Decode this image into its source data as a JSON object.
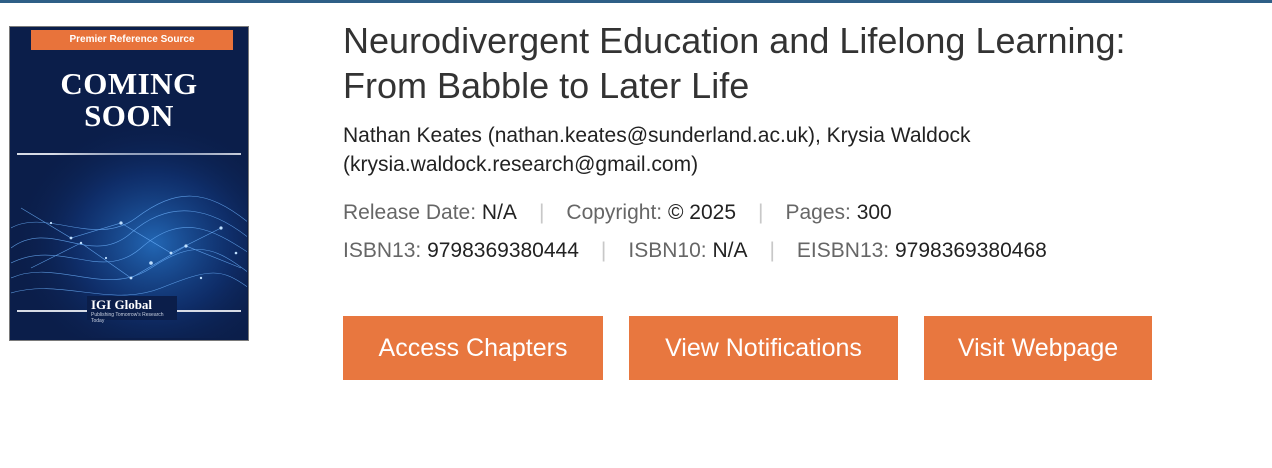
{
  "cover": {
    "banner": "Premier Reference Source",
    "title_line1": "COMING",
    "title_line2": "SOON",
    "publisher": "IGI Global",
    "publisher_tagline": "Publishing Tomorrow's Research Today"
  },
  "book": {
    "title_line1": "Neurodivergent Education and Lifelong Learning:",
    "title_line2": "From Babble to Later Life",
    "authors_line1": "Nathan Keates (nathan.keates@sunderland.ac.uk), Krysia Waldock",
    "authors_line2": "(krysia.waldock.research@gmail.com)"
  },
  "meta": {
    "separator": "|",
    "release_label": "Release Date:",
    "release_value": "N/A",
    "copyright_label": "Copyright:",
    "copyright_value": "© 2025",
    "pages_label": "Pages:",
    "pages_value": "300",
    "isbn13_label": "ISBN13:",
    "isbn13_value": "9798369380444",
    "isbn10_label": "ISBN10:",
    "isbn10_value": "N/A",
    "eisbn13_label": "EISBN13:",
    "eisbn13_value": "9798369380468"
  },
  "actions": {
    "access_chapters": "Access Chapters",
    "view_notifications": "View Notifications",
    "visit_webpage": "Visit Webpage"
  },
  "colors": {
    "accent": "#e8773f",
    "top_rule": "#2f5f87",
    "cover_bg": "#0b1e4a"
  }
}
